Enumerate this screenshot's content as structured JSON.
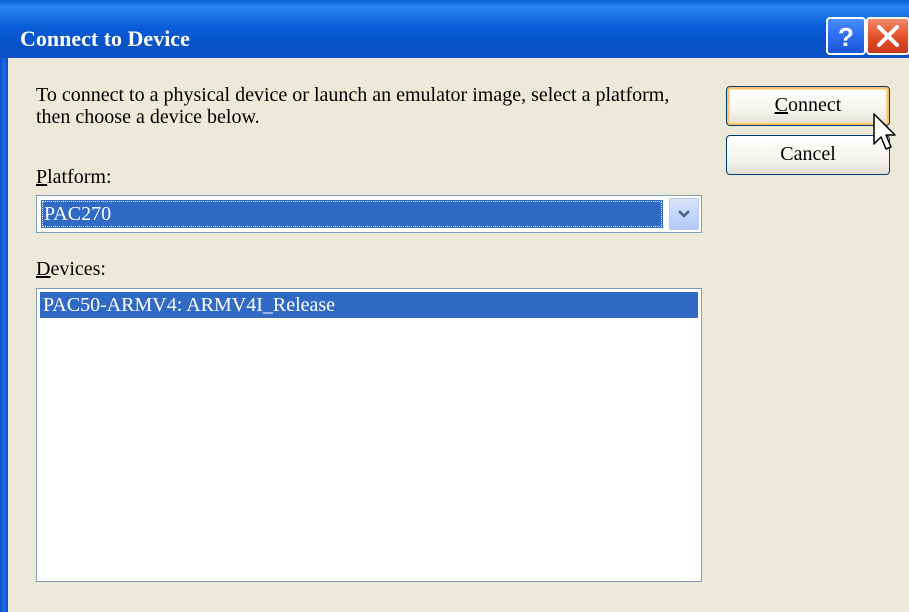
{
  "window": {
    "title": "Connect to Device"
  },
  "titlebar_buttons": {
    "help_icon": "question-mark",
    "close_icon": "x"
  },
  "description": "To connect to a physical device or launch an emulator image, select a platform, then choose a device below.",
  "platform": {
    "label_accesskey": "P",
    "label_rest": "latform:",
    "selected_value": "PAC270"
  },
  "devices": {
    "label_accesskey": "D",
    "label_rest": "evices:",
    "items": [
      {
        "label": "PAC50-ARMV4: ARMV4I_Release",
        "selected": true
      }
    ]
  },
  "buttons": {
    "connect_accesskey": "C",
    "connect_rest": "onnect",
    "cancel_label": "Cancel"
  },
  "colors": {
    "titlebar": "#0b5ed9",
    "dialog_bg": "#ece9d8",
    "selection": "#316ac5",
    "close_button": "#e5522b"
  }
}
